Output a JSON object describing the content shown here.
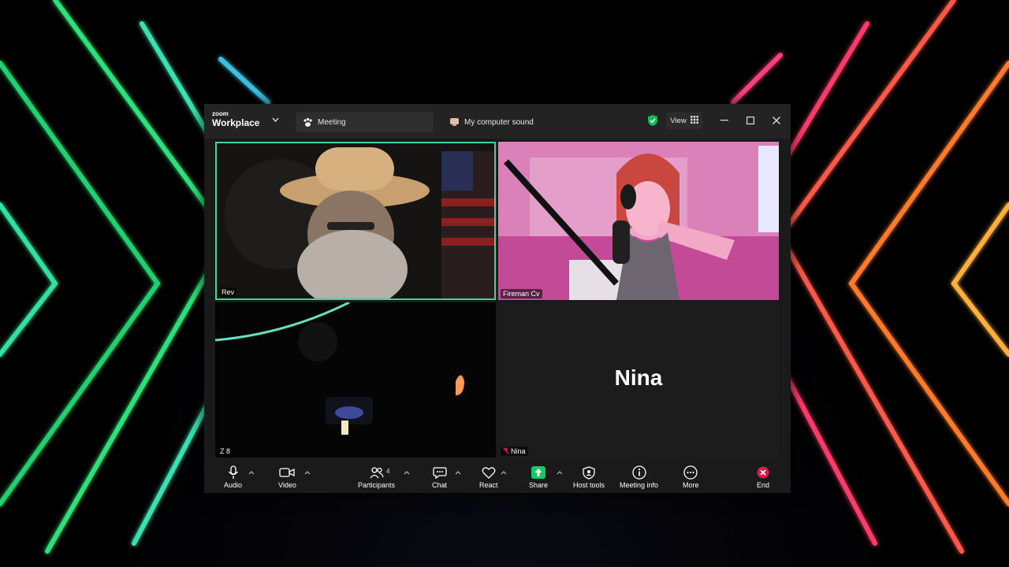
{
  "window": {
    "brand_small": "zoom",
    "brand_big": "Workplace",
    "tabs": [
      {
        "label": "Meeting",
        "icon": "paw-icon"
      },
      {
        "label": "My computer sound",
        "icon": "computer-sound-icon"
      }
    ],
    "view_label": "View",
    "colors": {
      "accent": "#3fd59a",
      "end": "#e0174c",
      "share": "#17c964"
    }
  },
  "tiles": [
    {
      "name": "Rev",
      "active_speaker": true
    },
    {
      "name": "Fireman Cv"
    },
    {
      "name": "Z 8"
    },
    {
      "name": "Nina",
      "avatar_text": "Nina",
      "muted": true
    }
  ],
  "toolbar": {
    "audio": "Audio",
    "video": "Video",
    "participants": "Participants",
    "participants_count": "4",
    "chat": "Chat",
    "react": "React",
    "share": "Share",
    "host_tools": "Host tools",
    "meeting_info": "Meeting info",
    "more": "More",
    "end": "End"
  }
}
